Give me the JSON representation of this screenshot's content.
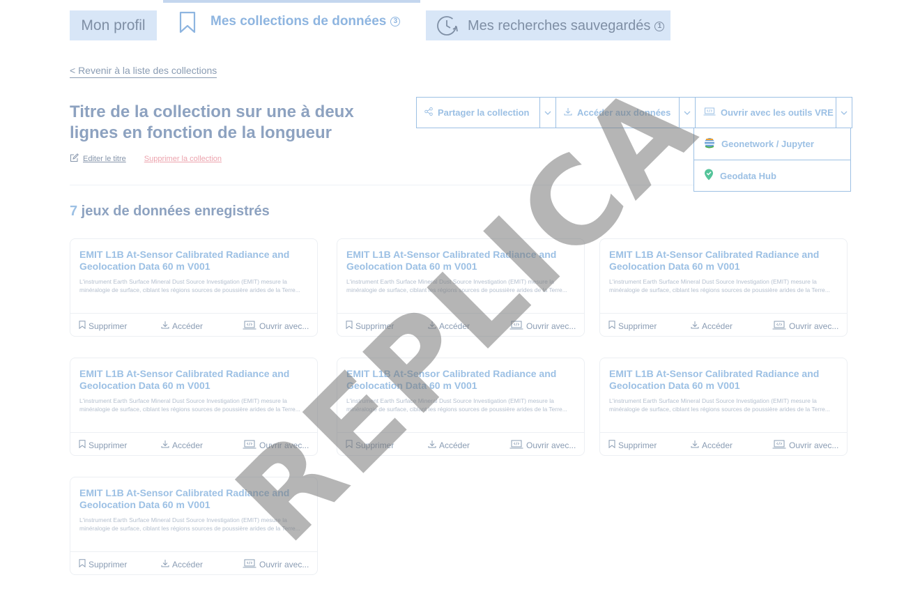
{
  "tabs": {
    "profil": "Mon profil",
    "collections": "Mes collections de données",
    "collections_count": "3",
    "recherches": "Mes recherches sauvegardés",
    "recherches_count": "1"
  },
  "back_link": "< Revenir à la liste des collections",
  "collection": {
    "title": "Titre de la collection sur une à deux lignes en fonction de la longueur",
    "edit_label": "Editer le titre",
    "delete_label": "Supprimer la collection"
  },
  "actions": {
    "share": "Partager la collection",
    "access": "Accéder aux données",
    "vre": "Ouvrir avec les outils VRE",
    "dropdown": [
      "Geonetwork / Jupyter",
      "Geodata Hub"
    ]
  },
  "datasets": {
    "count": "7",
    "label": " jeux de données enregistrés"
  },
  "cards": [
    {
      "title": "EMIT L1B At-Sensor Calibrated Radiance and Geolocation Data 60 m V001",
      "desc": "L'instrument Earth Surface Mineral Dust Source Investigation (EMIT) mesure la minéralogie de surface, ciblant les régions sources de poussière arides de la Terre...",
      "delete": "Supprimer",
      "access": "Accéder",
      "open": "Ouvrir avec..."
    },
    {
      "title": "EMIT L1B At-Sensor Calibrated Radiance and Geolocation Data 60 m V001",
      "desc": "L'instrument Earth Surface Mineral Dust Source Investigation (EMIT) mesure la minéralogie de surface, ciblant les régions sources de poussière arides de la Terre...",
      "delete": "Supprimer",
      "access": "Accéder",
      "open": "Ouvrir avec..."
    },
    {
      "title": "EMIT L1B At-Sensor Calibrated Radiance and Geolocation Data 60 m V001",
      "desc": "L'instrument Earth Surface Mineral Dust Source Investigation (EMIT) mesure la minéralogie de surface, ciblant les régions sources de poussière arides de la Terre...",
      "delete": "Supprimer",
      "access": "Accéder",
      "open": "Ouvrir avec..."
    },
    {
      "title": "EMIT L1B At-Sensor Calibrated Radiance and Geolocation Data 60 m V001",
      "desc": "L'instrument Earth Surface Mineral Dust Source Investigation (EMIT) mesure la minéralogie de surface, ciblant les régions sources de poussière arides de la Terre...",
      "delete": "Supprimer",
      "access": "Accéder",
      "open": "Ouvrir avec..."
    },
    {
      "title": "EMIT L1B At-Sensor Calibrated Radiance and Geolocation Data 60 m V001",
      "desc": "L'instrument Earth Surface Mineral Dust Source Investigation (EMIT) mesure la minéralogie de surface, ciblant les régions sources de poussière arides de la Terre...",
      "delete": "Supprimer",
      "access": "Accéder",
      "open": "Ouvrir avec..."
    },
    {
      "title": "EMIT L1B At-Sensor Calibrated Radiance and Geolocation Data 60 m V001",
      "desc": "L'instrument Earth Surface Mineral Dust Source Investigation (EMIT) mesure la minéralogie de surface, ciblant les régions sources de poussière arides de la Terre...",
      "delete": "Supprimer",
      "access": "Accéder",
      "open": "Ouvrir avec..."
    },
    {
      "title": "EMIT L1B At-Sensor Calibrated Radiance and Geolocation Data 60 m V001",
      "desc": "L'instrument Earth Surface Mineral Dust Source Investigation (EMIT) mesure la minéralogie de surface, ciblant les régions sources de poussière arides de la Terre...",
      "delete": "Supprimer",
      "access": "Accéder",
      "open": "Ouvrir avec..."
    }
  ],
  "watermark": "REPLICA",
  "colors": {
    "accent": "#9cc0e4",
    "tab_bg": "#d8e6f7",
    "danger": "#eca3ad",
    "heading": "#8da2c0"
  }
}
